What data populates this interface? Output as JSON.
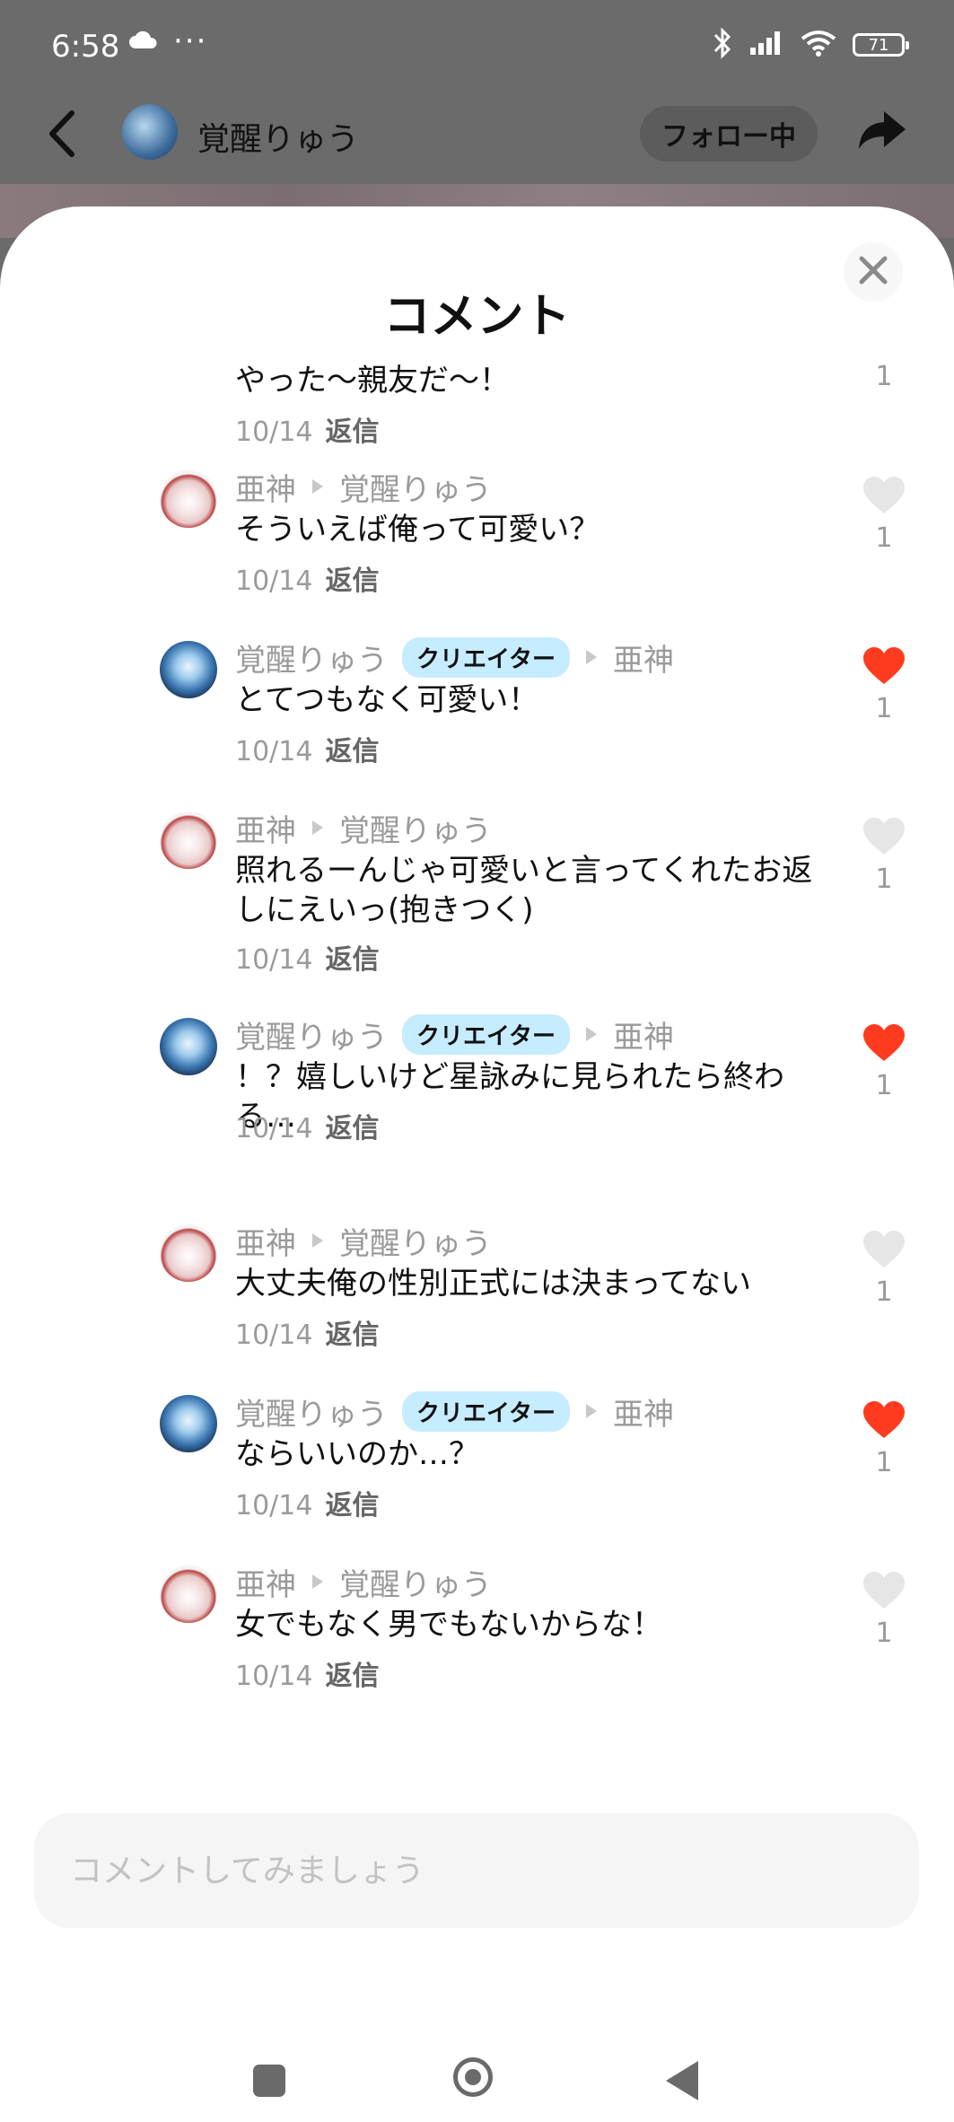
{
  "status_bar": {
    "time": "6:58",
    "dots": "···",
    "battery": "71"
  },
  "header": {
    "user_name": "覚醒りゅう",
    "follow_label": "フォロー中"
  },
  "sheet": {
    "title": "コメント"
  },
  "reply_label": "返信",
  "creator_badge": "クリエイター",
  "comments": [
    {
      "author": "",
      "target": "",
      "text": "やった〜親友だ〜！",
      "date": "10/14",
      "likes": "1",
      "liked": false,
      "show_heart": false,
      "creator": false
    },
    {
      "author": "亜神",
      "target": "覚醒りゅう",
      "text": "そういえば俺って可愛い？",
      "date": "10/14",
      "likes": "1",
      "liked": false,
      "show_heart": true,
      "creator": false
    },
    {
      "author": "覚醒りゅう",
      "target": "亜神",
      "text": "とてつもなく可愛い！",
      "date": "10/14",
      "likes": "1",
      "liked": true,
      "show_heart": true,
      "creator": true
    },
    {
      "author": "亜神",
      "target": "覚醒りゅう",
      "text": "照れるーんじゃ可愛いと言ってくれたお返しにえいっ(抱きつく)",
      "date": "10/14",
      "likes": "1",
      "liked": false,
      "show_heart": true,
      "creator": false
    },
    {
      "author": "覚醒りゅう",
      "target": "亜神",
      "text": "！？嬉しいけど星詠みに見られたら終わる…",
      "date": "10/14",
      "likes": "1",
      "liked": true,
      "show_heart": true,
      "creator": true
    },
    {
      "author": "亜神",
      "target": "覚醒りゅう",
      "text": "大丈夫俺の性別正式には決まってない",
      "date": "10/14",
      "likes": "1",
      "liked": false,
      "show_heart": true,
      "creator": false
    },
    {
      "author": "覚醒りゅう",
      "target": "亜神",
      "text": "ならいいのか…？",
      "date": "10/14",
      "likes": "1",
      "liked": true,
      "show_heart": true,
      "creator": true
    },
    {
      "author": "亜神",
      "target": "覚醒りゅう",
      "text": "女でもなく男でもないからな！",
      "date": "10/14",
      "likes": "1",
      "liked": false,
      "show_heart": true,
      "creator": false
    }
  ],
  "input": {
    "placeholder": "コメントしてみましょう"
  },
  "colors": {
    "like_active": "#ff3b1f",
    "like_inactive": "#e6e6e6",
    "badge_bg": "#c6ecff"
  }
}
